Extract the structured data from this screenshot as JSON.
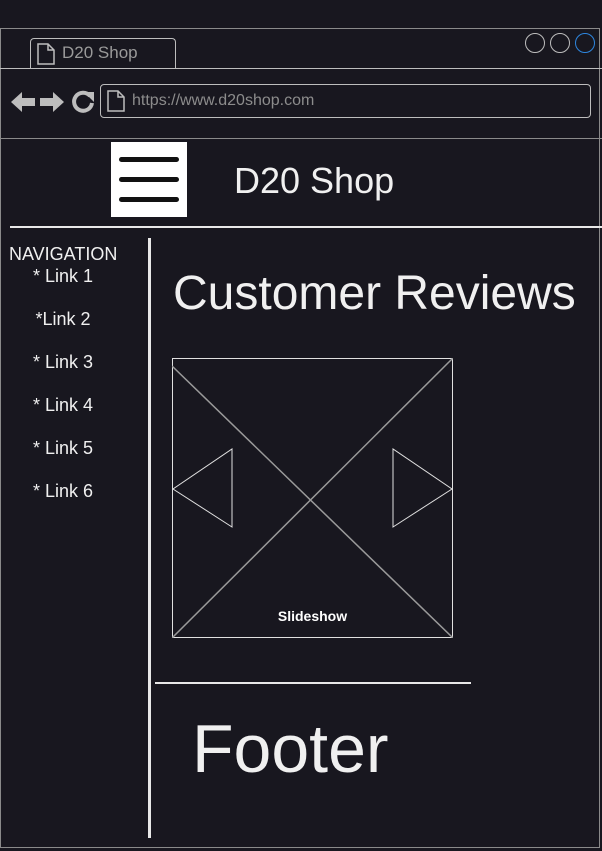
{
  "browser": {
    "tab_title": "D20 Shop",
    "url": "https://www.d20shop.com"
  },
  "header": {
    "site_title": "D20 Shop"
  },
  "sidebar": {
    "heading": "NAVIGATION",
    "links": [
      "* Link 1",
      "*Link 2",
      "* Link 3",
      "* Link 4",
      "* Link 5",
      "* Link 6"
    ]
  },
  "main": {
    "title": "Customer Reviews",
    "slideshow_label": "Slideshow"
  },
  "footer": {
    "text": "Footer"
  },
  "colors": {
    "background": "#18171f",
    "window_active_button": "#2e86de"
  },
  "icons": [
    "back-arrow-icon",
    "forward-arrow-icon",
    "reload-icon",
    "page-icon",
    "hamburger-menu-icon",
    "previous-arrow-icon",
    "next-arrow-icon"
  ]
}
